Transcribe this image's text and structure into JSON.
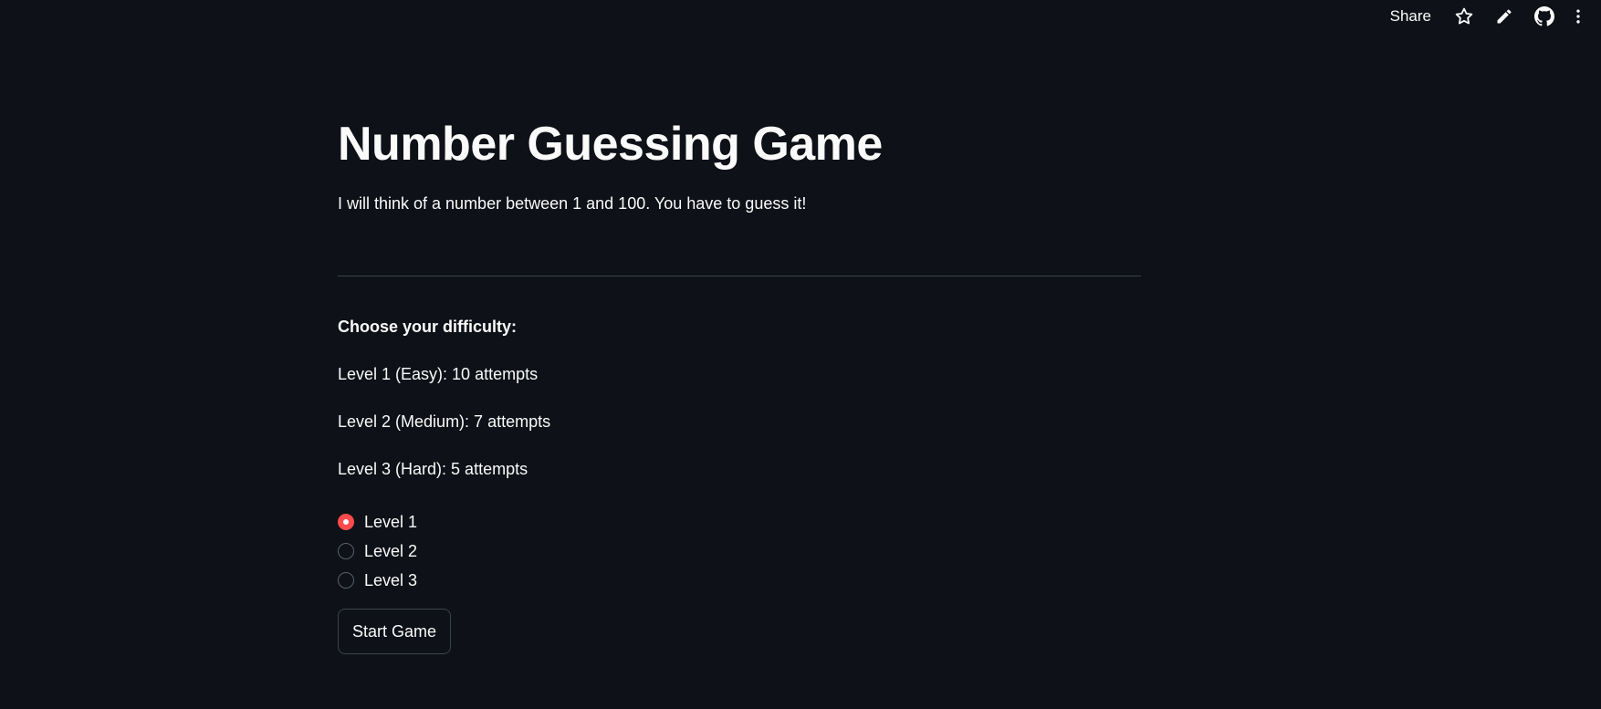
{
  "toolbar": {
    "share_label": "Share",
    "icons": [
      "star-icon",
      "pencil-icon",
      "github-icon",
      "more-vertical-icon"
    ]
  },
  "main": {
    "title": "Number Guessing Game",
    "intro": "I will think of a number between 1 and 100. You have to guess it!",
    "difficulty_heading": "Choose your difficulty:",
    "levels_info": [
      "Level 1 (Easy): 10 attempts",
      "Level 2 (Medium): 7 attempts",
      "Level 3 (Hard): 5 attempts"
    ],
    "radio_options": [
      "Level 1",
      "Level 2",
      "Level 3"
    ],
    "selected_option": "Level 1",
    "start_button_label": "Start Game"
  },
  "colors": {
    "background": "#0e1117",
    "text": "#fafafa",
    "accent": "#ff4b4b",
    "border": "#3d4250"
  }
}
